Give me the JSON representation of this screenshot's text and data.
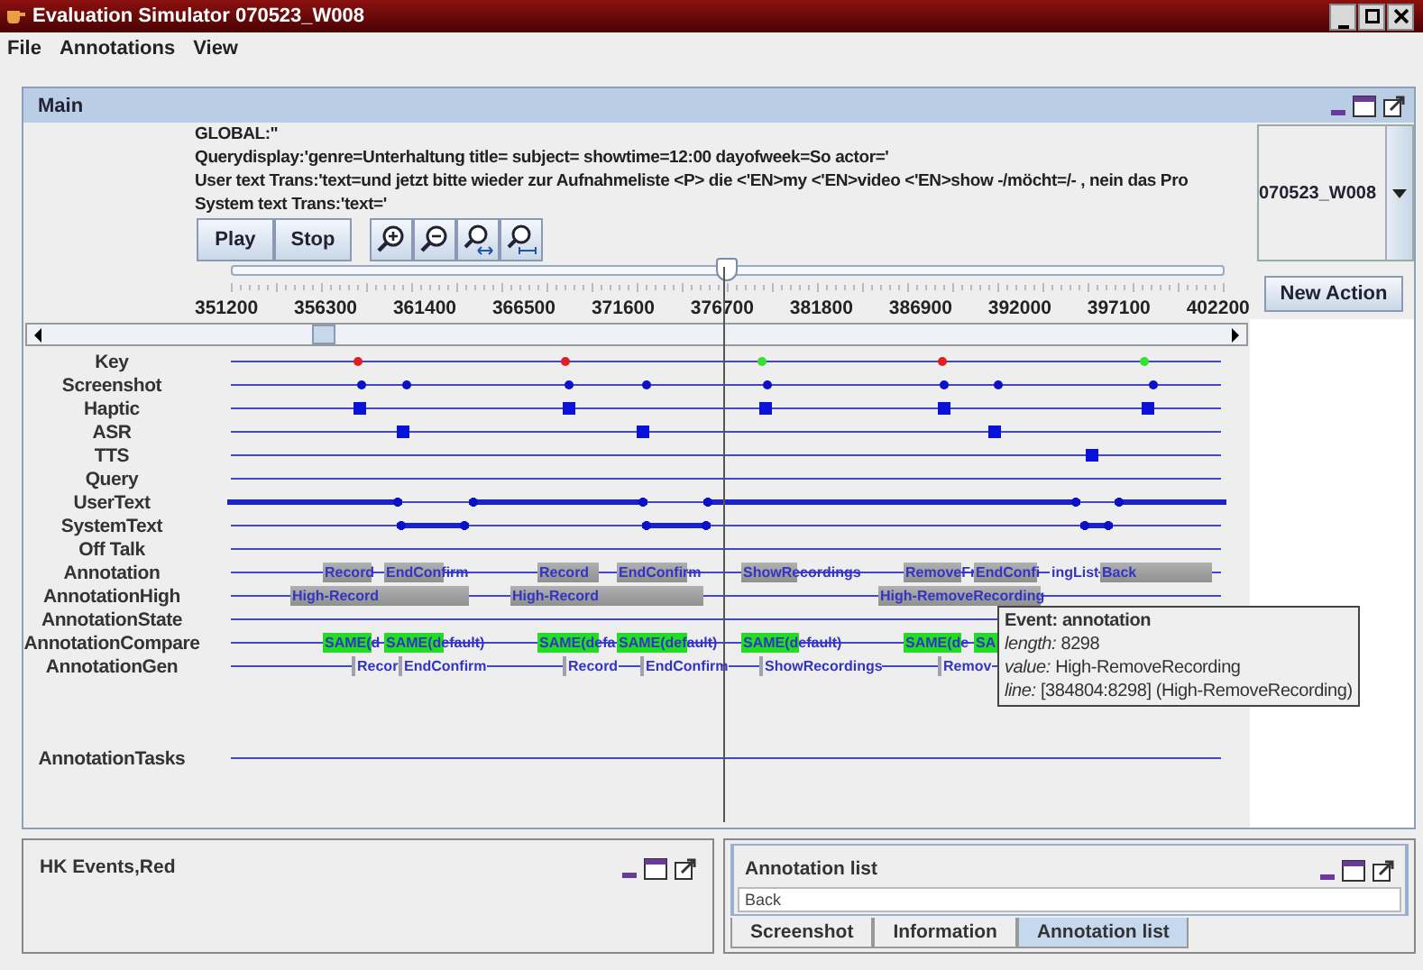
{
  "window": {
    "title": "Evaluation Simulator 070523_W008"
  },
  "menu": [
    "File",
    "Annotations",
    "View"
  ],
  "main_panel": {
    "title": "Main",
    "info_lines": [
      "GLOBAL:''",
      "Querydisplay:'genre=Unterhaltung title= subject= showtime=12:00 dayofweek=So actor='",
      "User text Trans:'text=und jetzt bitte wieder zur Aufnahmeliste <P> die <'EN>my <'EN>video <'EN>show -/möcht=/- , nein das Pro",
      "System text Trans:'text='"
    ],
    "buttons": [
      "Play",
      "Stop"
    ],
    "tool_buttons": [
      {
        "kind": "zoom-in"
      },
      {
        "kind": "zoom-out"
      },
      {
        "kind": "zoom-stretch"
      },
      {
        "kind": "zoom-range"
      }
    ],
    "position_slider": {
      "level": 0.497
    },
    "axis_labels": [
      "351200",
      "356300",
      "361400",
      "366500",
      "371600",
      "376700",
      "381800",
      "386900",
      "392000",
      "397100",
      "402200"
    ],
    "session_select": {
      "value": "070523_W008"
    },
    "new_action_button": "New Action",
    "tracks": [
      {
        "name": "Key",
        "events": [
          {
            "kind": "dot",
            "color": "#e02020"
          },
          {
            "kind": "dot",
            "color": "#e02020"
          },
          {
            "kind": "dot",
            "color": "#33e033"
          },
          {
            "kind": "dot",
            "color": "#e02020"
          },
          {
            "kind": "dot",
            "color": "#33e033"
          }
        ]
      },
      {
        "name": "Screenshot",
        "events": [
          {
            "kind": "dot"
          },
          {
            "kind": "dot"
          },
          {
            "kind": "dot"
          },
          {
            "kind": "dot"
          },
          {
            "kind": "dot"
          },
          {
            "kind": "dot"
          },
          {
            "kind": "dot"
          },
          {
            "kind": "dot"
          }
        ]
      },
      {
        "name": "Haptic",
        "events": [
          {
            "kind": "square"
          },
          {
            "kind": "square"
          },
          {
            "kind": "square"
          },
          {
            "kind": "square"
          },
          {
            "kind": "square"
          }
        ]
      },
      {
        "name": "ASR",
        "events": [
          {
            "kind": "square"
          },
          {
            "kind": "square"
          },
          {
            "kind": "square"
          }
        ]
      },
      {
        "name": "TTS",
        "events": [
          {
            "kind": "square"
          }
        ]
      },
      {
        "name": "Query"
      },
      {
        "name": "UserText",
        "events": [
          {
            "kind": "span"
          },
          {
            "kind": "span"
          },
          {
            "kind": "span"
          },
          {
            "kind": "span"
          }
        ]
      },
      {
        "name": "SystemText",
        "events": [
          {
            "kind": "span"
          },
          {
            "kind": "span"
          },
          {
            "kind": "span"
          }
        ]
      },
      {
        "name": "Off Talk"
      },
      {
        "name": "Annotation",
        "events": [
          {
            "kind": "block",
            "label": "Record"
          },
          {
            "kind": "block",
            "label": "EndConfirm"
          },
          {
            "kind": "block",
            "label": "Record"
          },
          {
            "kind": "block",
            "label": "EndConfirm"
          },
          {
            "kind": "block",
            "label": "ShowRecordings"
          },
          {
            "kind": "block",
            "label": "RemoveFr"
          },
          {
            "kind": "block",
            "label": "EndConfi"
          },
          {
            "kind": "text",
            "label": "ingList"
          },
          {
            "kind": "block",
            "label": "Back"
          }
        ]
      },
      {
        "name": "AnnotationHigh",
        "events": [
          {
            "kind": "block",
            "label": "High-Record"
          },
          {
            "kind": "block",
            "label": "High-Record"
          },
          {
            "kind": "block",
            "label": "High-RemoveRecording"
          }
        ]
      },
      {
        "name": "AnnotationState"
      },
      {
        "name": "AnnotationCompare",
        "events": [
          {
            "kind": "match-block",
            "label": "SAME(d"
          },
          {
            "kind": "match-block",
            "label": "SAME(default)"
          },
          {
            "kind": "match-block",
            "label": "SAME(defa"
          },
          {
            "kind": "match-block",
            "label": "SAME(default)"
          },
          {
            "kind": "match-block",
            "label": "SAME(default)"
          },
          {
            "kind": "match-block",
            "label": "SAME(de"
          },
          {
            "kind": "match-block",
            "label": "SA"
          }
        ]
      },
      {
        "name": "AnnotationGen",
        "events": [
          {
            "kind": "marker",
            "label": "Recor"
          },
          {
            "kind": "marker",
            "label": "EndConfirm"
          },
          {
            "kind": "marker",
            "label": "Record"
          },
          {
            "kind": "marker",
            "label": "EndConfirm"
          },
          {
            "kind": "marker",
            "label": "ShowRecordings"
          },
          {
            "kind": "marker",
            "label": "Remov"
          }
        ]
      }
    ],
    "task_track": {
      "name": "AnnotationTasks"
    },
    "tooltip": {
      "lines": [
        "Event: annotation",
        "*length:* 8298",
        "*value:* High-RemoveRecording",
        "*line:* [384804:8298] (High-RemoveRecording)"
      ]
    }
  },
  "bottom_panels": [
    {
      "title": "HK Events,Red"
    },
    {
      "title": "Annotation list",
      "list_items": [
        "Back"
      ],
      "tabs": [
        {
          "label": "Screenshot",
          "selected": false
        },
        {
          "label": "Information",
          "selected": false
        },
        {
          "label": "Annotation list",
          "selected": true
        }
      ]
    }
  ]
}
